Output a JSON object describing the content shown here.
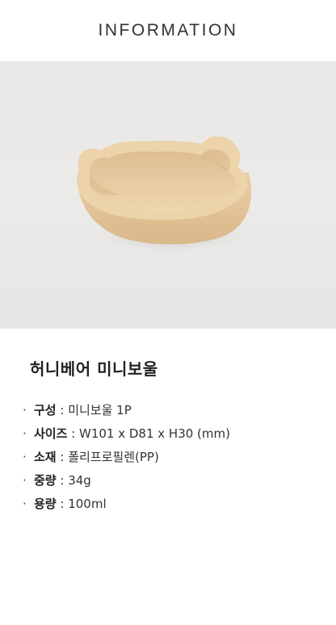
{
  "header": {
    "title": "INFORMATION"
  },
  "product": {
    "name": "허니베어 미니보울",
    "image_alt": "beige bear-shaped mini bowl"
  },
  "specs": [
    {
      "label": "구성",
      "value": "미니보울 1P"
    },
    {
      "label": "사이즈",
      "value": "W101 x D81 x H30 (mm)"
    },
    {
      "label": "소재",
      "value": "폴리프로필렌(PP)"
    },
    {
      "label": "중량",
      "value": "34g"
    },
    {
      "label": "용량",
      "value": "100ml"
    }
  ],
  "colors": {
    "bowl": "#e7c99f",
    "photo_bg": "#eae9e7"
  },
  "bullet_symbol": "·",
  "separator": " : "
}
